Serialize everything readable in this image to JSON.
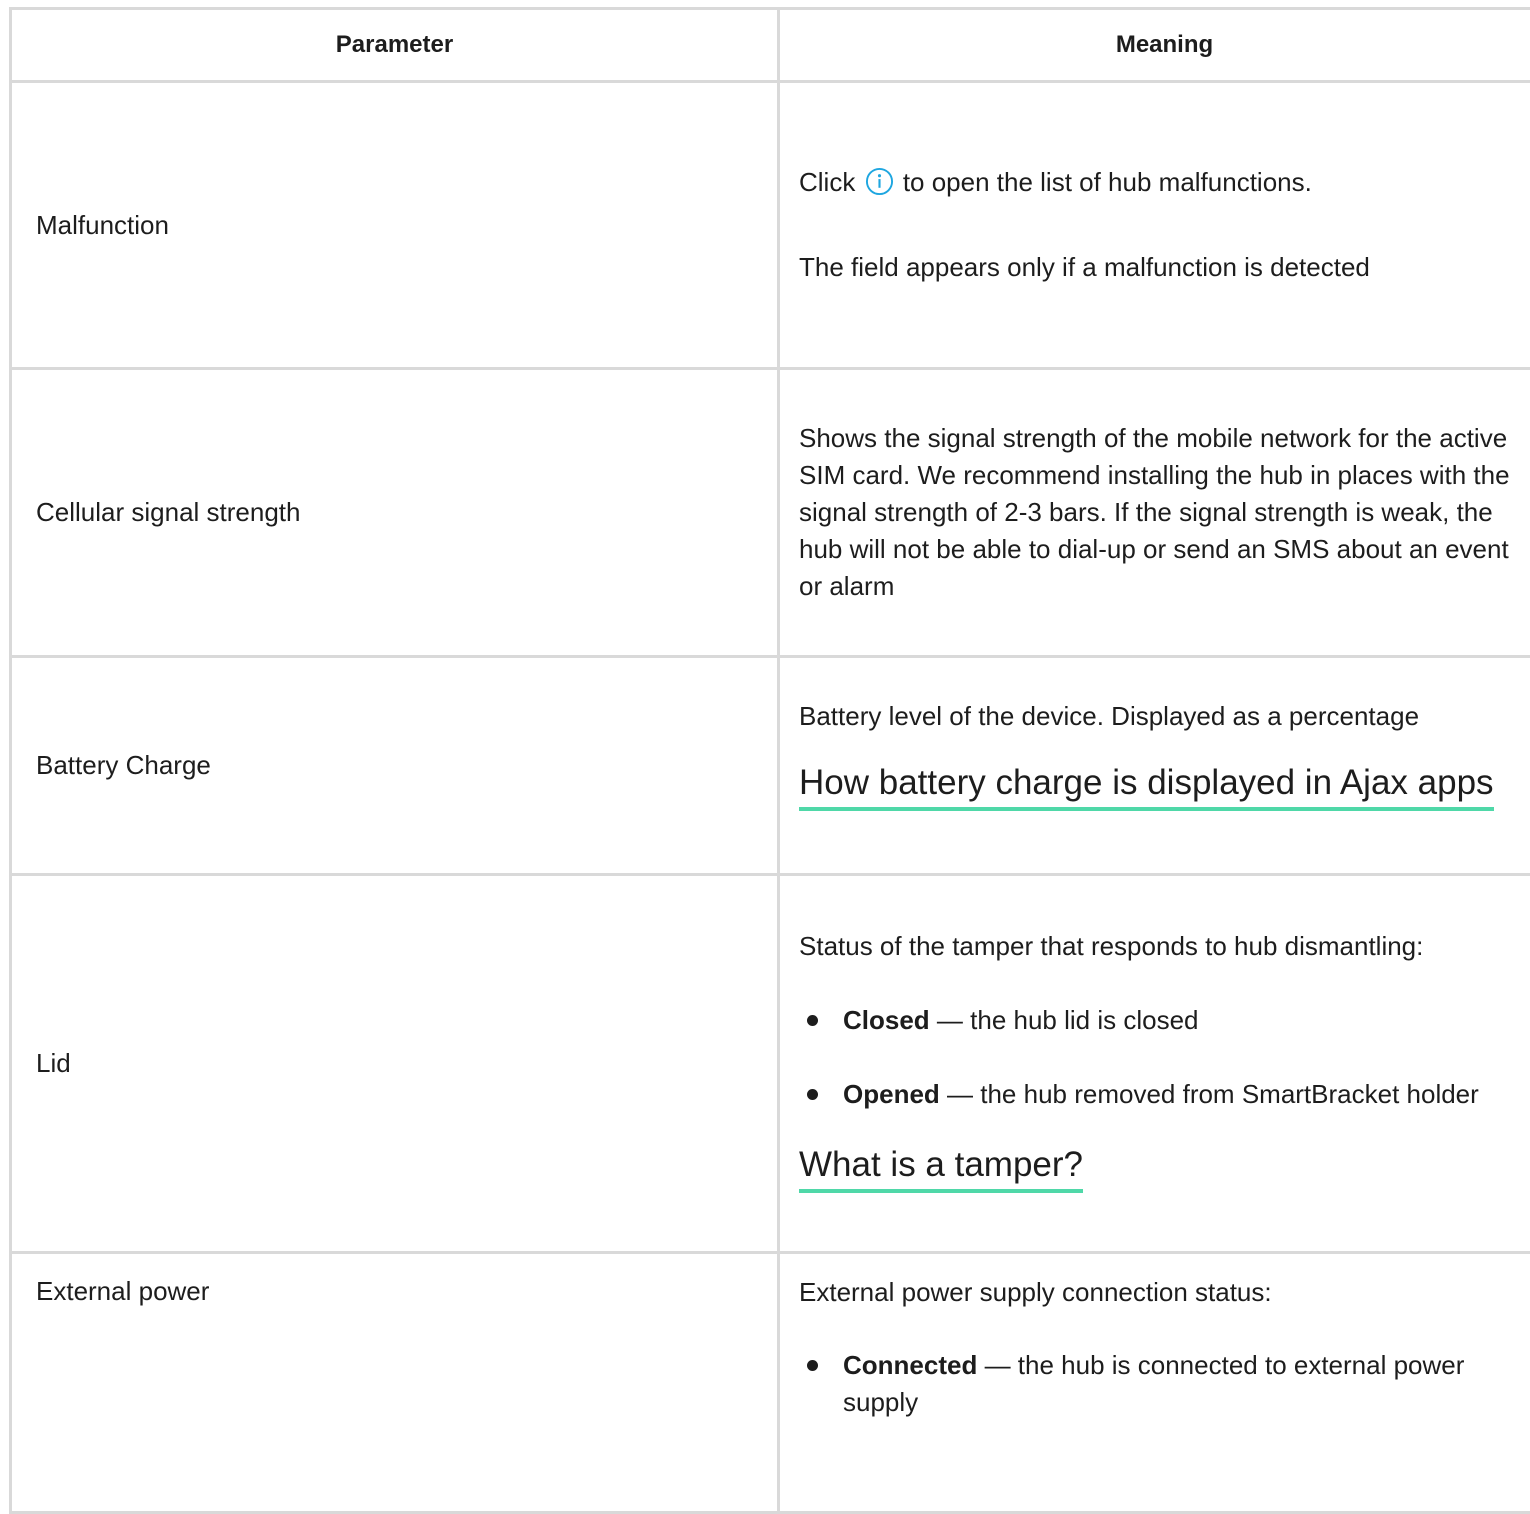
{
  "table": {
    "headers": {
      "parameter": "Parameter",
      "meaning": "Meaning"
    },
    "rows": {
      "malfunction": {
        "parameter": "Malfunction",
        "line1_before": "Click",
        "line1_icon": "info-icon",
        "line1_after": "to open the list of hub malfunctions.",
        "line2": "The field appears only if a malfunction is detected"
      },
      "cellular": {
        "parameter": "Cellular signal strength",
        "text": "Shows the signal strength of the mobile network for the active SIM card. We recommend installing the hub in places with the signal strength of 2-3 bars. If the signal strength is weak, the hub will not be able to dial-up or send an SMS about an event or alarm"
      },
      "battery": {
        "parameter": "Battery Charge",
        "text": "Battery level of the device. Displayed as a percentage",
        "link": "How battery charge is displayed in Ajax apps"
      },
      "lid": {
        "parameter": "Lid",
        "intro": "Status of the tamper that responds to hub dismantling:",
        "items": [
          {
            "term": "Closed",
            "desc": " — the hub lid is closed"
          },
          {
            "term": "Opened",
            "desc": " — the hub removed from SmartBracket holder"
          }
        ],
        "link": "What is a tamper?"
      },
      "external_power": {
        "parameter": "External power",
        "intro": "External power supply connection status:",
        "items": [
          {
            "term": "Connected",
            "desc": " — the hub is connected to external power supply"
          }
        ]
      }
    }
  },
  "colors": {
    "text": "#1d1d1d",
    "border": "#d9d9d9",
    "link_underline": "#4fd8a8",
    "info_icon": "#1ea6e0"
  }
}
